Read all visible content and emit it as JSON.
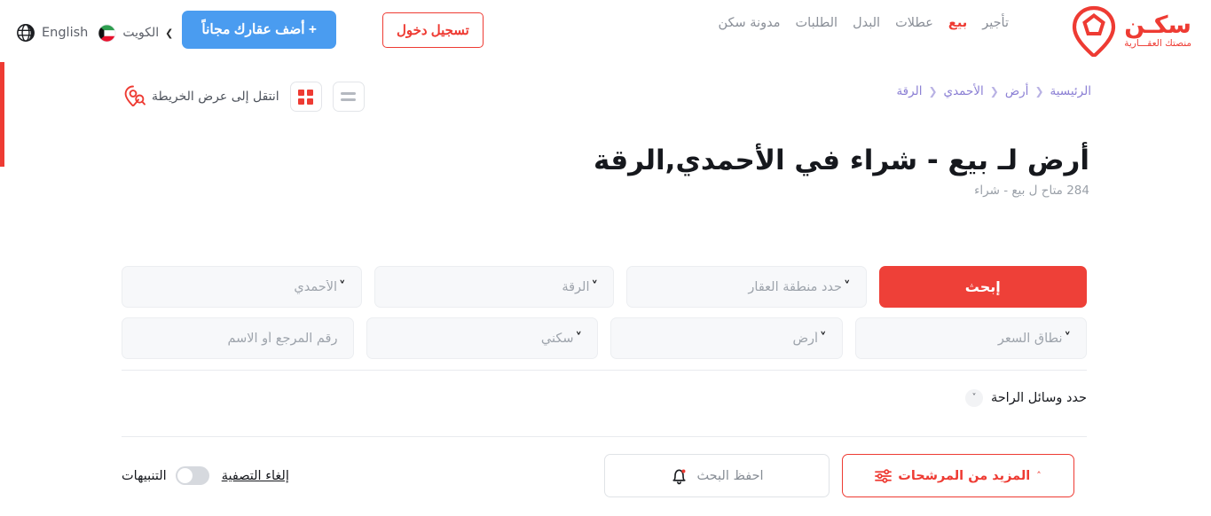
{
  "header": {
    "logo": {
      "word": "سكـن",
      "tagline": "منصتك العقـــارية",
      "pin_icon": "location-pin-icon"
    },
    "nav": [
      {
        "label": "تأجير",
        "active": false
      },
      {
        "label": "بيع",
        "active": true
      },
      {
        "label": "عطلات",
        "active": false
      },
      {
        "label": "البدل",
        "active": false
      },
      {
        "label": "الطلبات",
        "active": false
      },
      {
        "label": "مدونة سكن",
        "active": false
      }
    ],
    "login_label": "تسجيل دخول",
    "add_property_label": "+ أضف عقارك مجاناً",
    "country_label": "الكويت",
    "country_flag": "kuwait-flag-icon",
    "language_label": "English",
    "language_icon": "globe-icon",
    "chevron_icon": "chevron-down-icon"
  },
  "subbar": {
    "breadcrumb": [
      "الرئيسية",
      "أرض",
      "الأحمدي",
      "الرقة"
    ],
    "breadcrumb_separator": "❮",
    "map_link_label": "انتقل إلى عرض الخريطة",
    "map_link_icon": "map-search-pin-icon",
    "grid_view_icon": "grid-view-icon",
    "list_view_icon": "list-view-icon"
  },
  "title": {
    "heading": "أرض لـ بيع - شراء في الأحمدي,الرقة",
    "subheading": "284 متاح ل بيع - شراء"
  },
  "filters": {
    "row1": [
      {
        "name": "governorate",
        "value": "الأحمدي",
        "has_chevron": true
      },
      {
        "name": "area",
        "value": "الرقة",
        "has_chevron": true
      },
      {
        "name": "property-zone",
        "value": "حدد منطقة العقار",
        "has_chevron": true
      }
    ],
    "search_button_label": "إبحث",
    "row2": [
      {
        "name": "reference-or-name",
        "value": "رقم المرجع أو الاسم",
        "has_chevron": false
      },
      {
        "name": "purpose",
        "value": "سكني",
        "has_chevron": true
      },
      {
        "name": "property-type",
        "value": "أرض",
        "has_chevron": true
      },
      {
        "name": "price-range",
        "value": "نطاق السعر",
        "has_chevron": true
      }
    ],
    "amenities_label": "حدد وسائل الراحة",
    "amenities_chevron": "chevron-down-icon"
  },
  "actions": {
    "alerts_label": "التنبيهات",
    "alerts_on": false,
    "clear_filters_label": "إلغاء التصفية",
    "save_search_label": "احفظ البحث",
    "save_search_icon": "bell-icon",
    "more_filters_label": "المزيد من المرشحات",
    "more_filters_icon": "sliders-icon",
    "more_filters_chevron": "chevron-up-icon"
  },
  "colors": {
    "brand_red": "#ee3b33",
    "search_red": "#ee4038",
    "add_blue": "#4a9cf0",
    "breadcrumb_purple": "#8b7fd4",
    "field_bg": "#f7f8fa"
  }
}
